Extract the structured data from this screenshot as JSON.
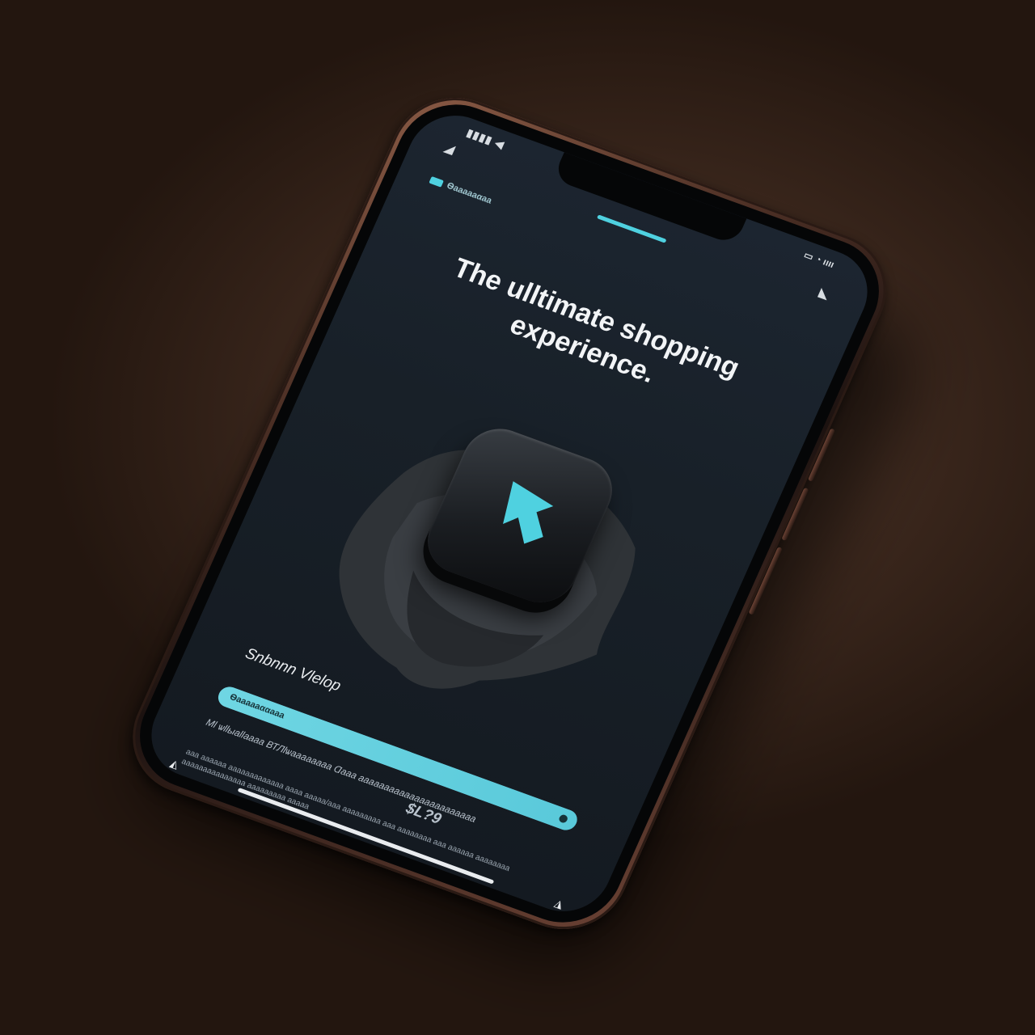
{
  "status_bar": {
    "left_text": "▮▮▮▮ ◀",
    "right_text": "▭ ◔ ıııı"
  },
  "header": {
    "brand_text": "Ѳаааааαаа"
  },
  "headline": {
    "title": "The ulltimate shopping experience."
  },
  "hero": {
    "icon_name": "up-arrow-icon",
    "accent_color": "#4fd1e0"
  },
  "product": {
    "subtitle": "Snbnnn Vlelop"
  },
  "progress": {
    "label": "Ѳаааааααааа",
    "value_percent": 100
  },
  "details": {
    "line_1": "Ml ѡllыаllаааа ВТЛlѡаааааааа Ɑааа ааааааааааааааааааааааа",
    "price": "$L?9",
    "line_2": "ааа аааааа ааааааааааааа аааа ааааа/ааа ааааааааа ааа аааааааа ааа аааааа аааааааа ааааааааааааааа ааааааааа ааааа"
  },
  "colors": {
    "accent": "#4fd1e0",
    "screen_bg": "#182028"
  }
}
